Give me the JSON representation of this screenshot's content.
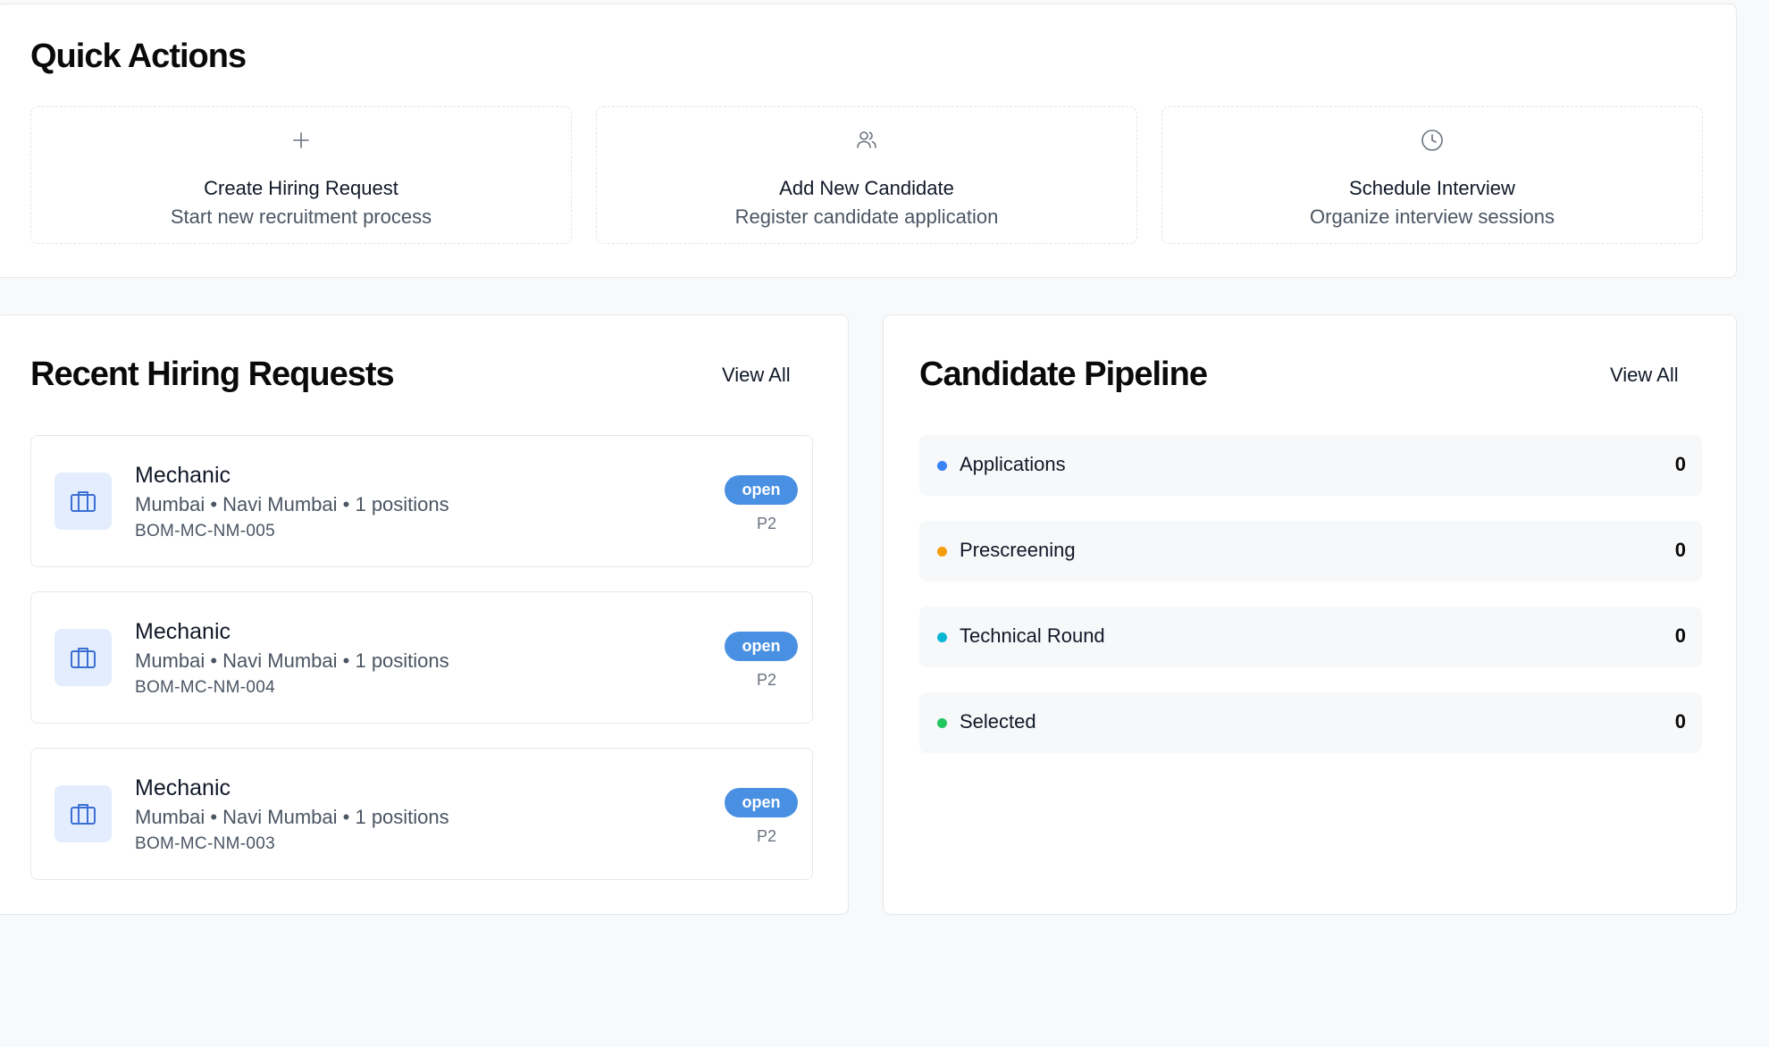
{
  "quick_actions": {
    "title": "Quick Actions",
    "tiles": [
      {
        "title": "Create Hiring Request",
        "subtitle": "Start new recruitment process",
        "icon": "plus-icon"
      },
      {
        "title": "Add New Candidate",
        "subtitle": "Register candidate application",
        "icon": "users-icon"
      },
      {
        "title": "Schedule Interview",
        "subtitle": "Organize interview sessions",
        "icon": "clock-icon"
      }
    ]
  },
  "recent_requests": {
    "title": "Recent Hiring Requests",
    "view_all": "View All",
    "items": [
      {
        "title": "Mechanic",
        "meta": "Mumbai • Navi Mumbai • 1 positions",
        "code": "BOM-MC-NM-005",
        "status": "open",
        "priority": "P2",
        "icon": "briefcase-icon"
      },
      {
        "title": "Mechanic",
        "meta": "Mumbai • Navi Mumbai • 1 positions",
        "code": "BOM-MC-NM-004",
        "status": "open",
        "priority": "P2",
        "icon": "briefcase-icon"
      },
      {
        "title": "Mechanic",
        "meta": "Mumbai • Navi Mumbai • 1 positions",
        "code": "BOM-MC-NM-003",
        "status": "open",
        "priority": "P2",
        "icon": "briefcase-icon"
      }
    ]
  },
  "pipeline": {
    "title": "Candidate Pipeline",
    "view_all": "View All",
    "stages": [
      {
        "label": "Applications",
        "count": "0",
        "color": "#3b82f6"
      },
      {
        "label": "Prescreening",
        "count": "0",
        "color": "#f59e0b"
      },
      {
        "label": "Technical Round",
        "count": "0",
        "color": "#06b6d4"
      },
      {
        "label": "Selected",
        "count": "0",
        "color": "#22c55e"
      }
    ]
  },
  "colors": {
    "accent": "#4a90e2",
    "icon_bg": "#e3edfd",
    "icon_fg": "#3b6fd4"
  }
}
